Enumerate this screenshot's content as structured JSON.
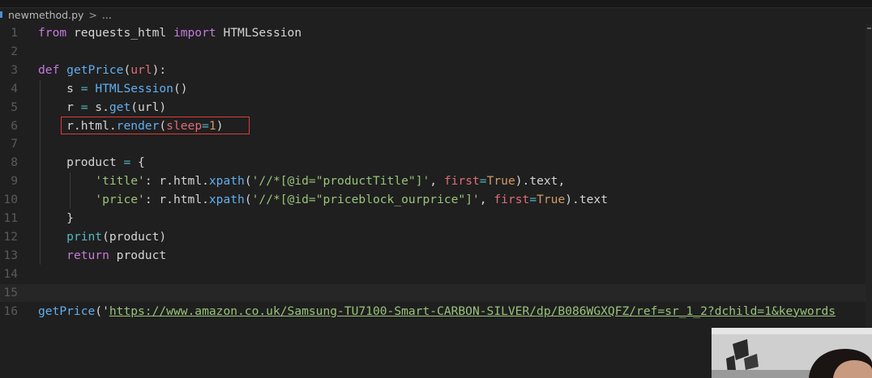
{
  "breadcrumb": {
    "file": "newmethod.py",
    "separator": ">",
    "trail": "..."
  },
  "editor": {
    "lines": [
      {
        "n": "1",
        "tokens": [
          {
            "t": "from",
            "c": "kw"
          },
          {
            "t": " requests_html ",
            "c": ""
          },
          {
            "t": "import",
            "c": "kw"
          },
          {
            "t": " HTMLSession",
            "c": ""
          }
        ]
      },
      {
        "n": "2",
        "tokens": []
      },
      {
        "n": "3",
        "tokens": [
          {
            "t": "def",
            "c": "kw"
          },
          {
            "t": " ",
            "c": ""
          },
          {
            "t": "getPrice",
            "c": "fn"
          },
          {
            "t": "(",
            "c": ""
          },
          {
            "t": "url",
            "c": "vr"
          },
          {
            "t": "):",
            "c": ""
          }
        ]
      },
      {
        "n": "4",
        "tokens": [
          {
            "t": "    s ",
            "c": ""
          },
          {
            "t": "=",
            "c": "op"
          },
          {
            "t": " ",
            "c": ""
          },
          {
            "t": "HTMLSession",
            "c": "fn"
          },
          {
            "t": "()",
            "c": ""
          }
        ]
      },
      {
        "n": "5",
        "tokens": [
          {
            "t": "    r ",
            "c": ""
          },
          {
            "t": "=",
            "c": "op"
          },
          {
            "t": " s.",
            "c": ""
          },
          {
            "t": "get",
            "c": "fn"
          },
          {
            "t": "(url)",
            "c": ""
          }
        ]
      },
      {
        "n": "6",
        "tokens": [
          {
            "t": "    r.html.",
            "c": ""
          },
          {
            "t": "render",
            "c": "fn"
          },
          {
            "t": "(",
            "c": ""
          },
          {
            "t": "sleep",
            "c": "vr"
          },
          {
            "t": "=",
            "c": "op"
          },
          {
            "t": "1",
            "c": "nm"
          },
          {
            "t": ")",
            "c": ""
          }
        ]
      },
      {
        "n": "7",
        "tokens": []
      },
      {
        "n": "8",
        "tokens": [
          {
            "t": "    product ",
            "c": ""
          },
          {
            "t": "=",
            "c": "op"
          },
          {
            "t": " {",
            "c": ""
          }
        ]
      },
      {
        "n": "9",
        "tokens": [
          {
            "t": "        ",
            "c": ""
          },
          {
            "t": "'title'",
            "c": "st"
          },
          {
            "t": ": r.html.",
            "c": ""
          },
          {
            "t": "xpath",
            "c": "fn"
          },
          {
            "t": "(",
            "c": ""
          },
          {
            "t": "'//*[@id=\"productTitle\"]'",
            "c": "st"
          },
          {
            "t": ", ",
            "c": ""
          },
          {
            "t": "first",
            "c": "vr"
          },
          {
            "t": "=",
            "c": "op"
          },
          {
            "t": "True",
            "c": "nm"
          },
          {
            "t": ").text,",
            "c": ""
          }
        ]
      },
      {
        "n": "10",
        "tokens": [
          {
            "t": "        ",
            "c": ""
          },
          {
            "t": "'price'",
            "c": "st"
          },
          {
            "t": ": r.html.",
            "c": ""
          },
          {
            "t": "xpath",
            "c": "fn"
          },
          {
            "t": "(",
            "c": ""
          },
          {
            "t": "'//*[@id=\"priceblock_ourprice\"]'",
            "c": "st"
          },
          {
            "t": ", ",
            "c": ""
          },
          {
            "t": "first",
            "c": "vr"
          },
          {
            "t": "=",
            "c": "op"
          },
          {
            "t": "True",
            "c": "nm"
          },
          {
            "t": ").text",
            "c": ""
          }
        ]
      },
      {
        "n": "11",
        "tokens": [
          {
            "t": "    }",
            "c": ""
          }
        ]
      },
      {
        "n": "12",
        "tokens": [
          {
            "t": "    ",
            "c": ""
          },
          {
            "t": "print",
            "c": "ct"
          },
          {
            "t": "(product)",
            "c": ""
          }
        ]
      },
      {
        "n": "13",
        "tokens": [
          {
            "t": "    ",
            "c": ""
          },
          {
            "t": "return",
            "c": "kw"
          },
          {
            "t": " product",
            "c": ""
          }
        ]
      },
      {
        "n": "14",
        "tokens": []
      },
      {
        "n": "15",
        "tokens": []
      },
      {
        "n": "16",
        "tokens": [
          {
            "t": "getPrice",
            "c": "fn"
          },
          {
            "t": "('",
            "c": ""
          },
          {
            "t": "https://www.amazon.co.uk/Samsung-TU7100-Smart-CARBON-SILVER/dp/B086WGXQFZ/ref=sr_1_2?dchild=1&keywords",
            "c": "url"
          }
        ]
      }
    ],
    "current_line": "15",
    "highlighted_line": "6"
  },
  "colors": {
    "background": "#1f1f1f",
    "keyword": "#c678dd",
    "function": "#61afef",
    "string": "#98c379",
    "number": "#d19a66",
    "parameter": "#e06c75",
    "highlight_box": "#e03a3a"
  }
}
